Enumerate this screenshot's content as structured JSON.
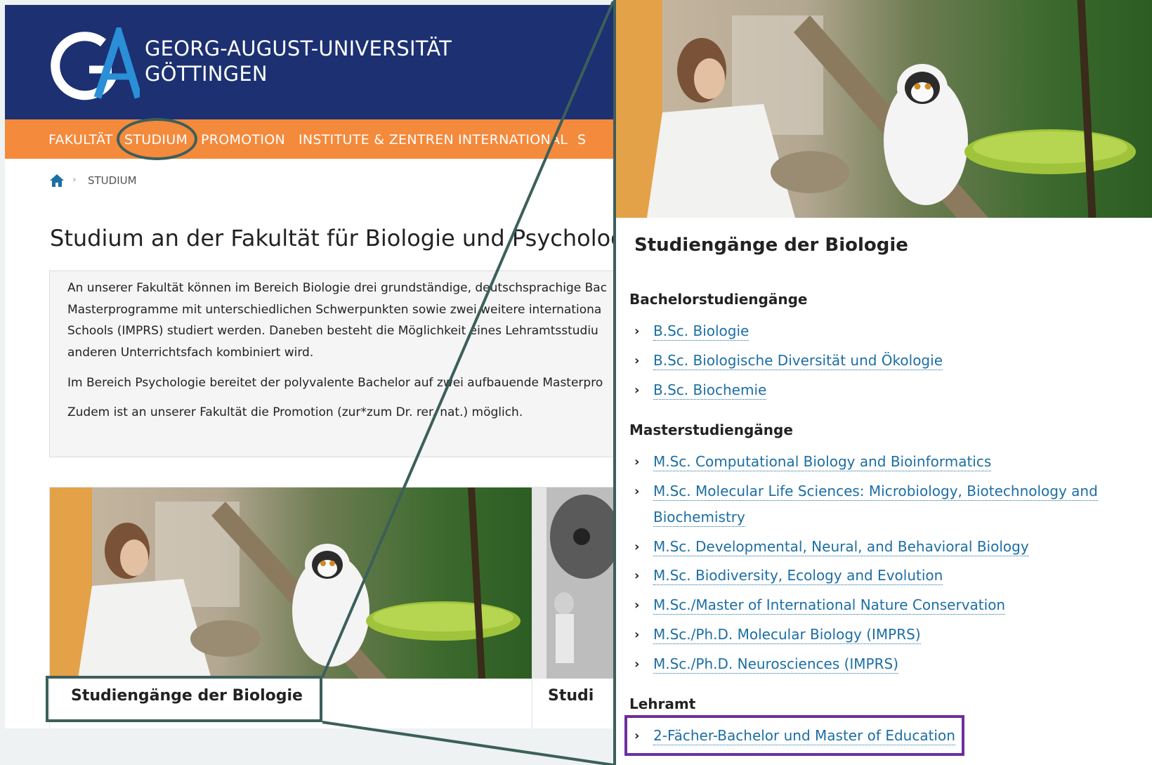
{
  "header": {
    "university_line1": "GEORG-AUGUST-UNIVERSITÄT",
    "university_line2": "GÖTTINGEN",
    "logo_letters": "GA"
  },
  "nav": {
    "items": [
      "FAKULTÄT",
      "STUDIUM",
      "PROMOTION",
      "INSTITUTE & ZENTREN",
      "INTERNATIONAL",
      "S"
    ]
  },
  "breadcrumb": {
    "home_icon": "home-icon",
    "current": "STUDIUM"
  },
  "page": {
    "title": "Studium an der Fakultät für Biologie und Psychologi",
    "intro": {
      "line1": "An unserer Fakultät können im Bereich Biologie drei grundständige, deutschsprachige Bac",
      "line2": "Masterprogramme mit unterschiedlichen Schwerpunkten sowie zwei weitere internationa",
      "line3": "Schools (IMPRS) studiert werden. Daneben besteht die Möglichkeit eines Lehramtsstudiu",
      "line4": "anderen Unterrichtsfach kombiniert wird.",
      "line5": "Im Bereich Psychologie bereitet der polyvalente Bachelor auf zwei aufbauende Masterpro",
      "line6": "Zudem ist an unserer Fakultät die Promotion (zur*zum Dr. rer. nat.) möglich."
    },
    "cards": [
      {
        "title": "Studiengänge der Biologie"
      },
      {
        "title": "Studi"
      }
    ]
  },
  "zoom": {
    "title": "Studiengänge der Biologie",
    "sections": [
      {
        "heading": "Bachelorstudiengänge",
        "links": [
          "B.Sc. Biologie",
          "B.Sc. Biologische Diversität und Ökologie",
          "B.Sc. Biochemie"
        ]
      },
      {
        "heading": "Masterstudiengänge",
        "links": [
          "M.Sc. Computational Biology and Bioinformatics",
          "M.Sc. Molecular Life Sciences: Microbiology, Biotechnology and",
          "Biochemistry",
          "M.Sc. Developmental, Neural, and Behavioral Biology",
          "M.Sc. Biodiversity, Ecology and Evolution",
          "M.Sc./Master of International Nature Conservation",
          "M.Sc./Ph.D. Molecular Biology (IMPRS)",
          "M.Sc./Ph.D. Neurosciences (IMPRS)"
        ]
      },
      {
        "heading": "Lehramt",
        "links": [
          "2-Fächer-Bachelor und Master of Education"
        ]
      }
    ]
  },
  "colors": {
    "header_blue": "#1c3072",
    "nav_orange": "#f48a3c",
    "link_blue": "#1c6ea4",
    "annotation_green": "#3c5f5a",
    "annotation_purple": "#6b2fa0"
  }
}
